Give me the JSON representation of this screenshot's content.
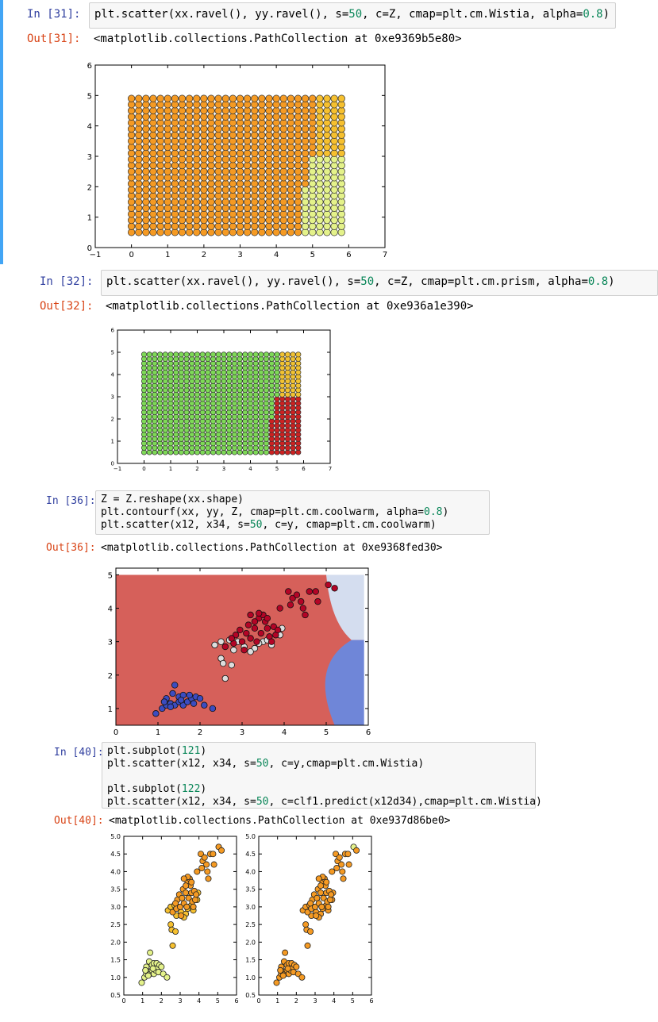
{
  "cells": [
    {
      "in_prompt": "In [31]:",
      "code_prefix": "plt.scatter(xx.ravel(), yy.ravel(), s=",
      "code_num1": "50",
      "code_mid": ", c=Z, cmap=plt.cm.Wistia, alpha=",
      "code_num2": "0.8",
      "code_suffix": ")",
      "out_prompt": "Out[31]:",
      "out_text": "<matplotlib.collections.PathCollection at 0xe9369b5e80>"
    },
    {
      "in_prompt": "In [32]:",
      "code_prefix": "plt.scatter(xx.ravel(), yy.ravel(), s=",
      "code_num1": "50",
      "code_mid": ", c=Z, cmap=plt.cm.prism, alpha=",
      "code_num2": "0.8",
      "code_suffix": ")",
      "out_prompt": "Out[32]:",
      "out_text": "<matplotlib.collections.PathCollection at 0xe936a1e390>"
    },
    {
      "in_prompt": "In [36]:",
      "line1": "Z = Z.reshape(xx.shape)",
      "line2_prefix": "plt.contourf(xx, yy, Z, cmap=plt.cm.coolwarm, alpha=",
      "line2_num": "0.8",
      "line2_suffix": ")",
      "line3_prefix": "plt.scatter(x12, x34, s=",
      "line3_num": "50",
      "line3_suffix": ", c=y, cmap=plt.cm.coolwarm)",
      "out_prompt": "Out[36]:",
      "out_text": "<matplotlib.collections.PathCollection at 0xe9368fed30>"
    },
    {
      "in_prompt": "In [40]:",
      "line1_prefix": "plt.subplot(",
      "line1_num": "121",
      "line1_suffix": ")",
      "line2_prefix": "plt.scatter(x12, x34, s=",
      "line2_num": "50",
      "line2_suffix": ", c=y,cmap=plt.cm.Wistia)",
      "line3_prefix": "plt.subplot(",
      "line3_num": "122",
      "line3_suffix": ")",
      "line4_prefix": "plt.scatter(x12, x34, s=",
      "line4_num": "50",
      "line4_suffix": ", c=clf1.predict(x12d34),cmap=plt.cm.Wistia)",
      "out_prompt": "Out[40]:",
      "out_text": "<matplotlib.collections.PathCollection at 0xe937d86be0>"
    }
  ],
  "colors": {
    "wistia_orange": "#f59a23",
    "wistia_amber": "#f6c02f",
    "wistia_lime": "#e4f28a",
    "prism_green": "#7ed957",
    "prism_yellow": "#f1c232",
    "prism_red": "#cc2222",
    "coolwarm_red_region": "#d6605a",
    "coolwarm_light_region": "#d4ddef",
    "coolwarm_blue_region": "#6f86d8",
    "point_red": "#b40426",
    "point_white": "#dddddd",
    "point_blue": "#3b4cc0"
  },
  "chart_data": [
    {
      "type": "scatter",
      "title": "",
      "xlim": [
        -1,
        7
      ],
      "ylim": [
        0,
        6
      ],
      "xticks": [
        -1,
        0,
        1,
        2,
        3,
        4,
        5,
        6,
        7
      ],
      "yticks": [
        0,
        1,
        2,
        3,
        4,
        5,
        6
      ],
      "grid_x": [
        0.0,
        5.8,
        0.2
      ],
      "grid_y": [
        0.5,
        5.0,
        0.2
      ],
      "colormap": "Wistia",
      "regions": "class 0 (orange) for x < 5.2; class 1 (amber) for x >= 5.2 and y >= 3.1; class 2 (lime) for x >= 5.2 and y < 3.1, boundary bending left toward x = 4.8 at low y"
    },
    {
      "type": "scatter",
      "title": "",
      "xlim": [
        -1,
        7
      ],
      "ylim": [
        0,
        6
      ],
      "xticks": [
        -1,
        0,
        1,
        2,
        3,
        4,
        5,
        6,
        7
      ],
      "yticks": [
        0,
        1,
        2,
        3,
        4,
        5,
        6
      ],
      "grid_x": [
        0.0,
        5.8,
        0.2
      ],
      "grid_y": [
        0.5,
        5.0,
        0.2
      ],
      "colormap": "prism",
      "regions": "class 0 (green) for x < 5.2; class 1 (yellow) for x >= 5.2 and y >= 3.1; class 2 (red) for x >= 5.2 and y < 3.1"
    },
    {
      "type": "scatter",
      "title": "",
      "xlim": [
        0,
        6
      ],
      "ylim": [
        0.5,
        5.2
      ],
      "xticks": [
        0,
        1,
        2,
        3,
        4,
        5,
        6
      ],
      "yticks": [
        1,
        2,
        3,
        4,
        5
      ],
      "colormap": "coolwarm",
      "background": "filled contour: red for most of plot, light blue region x > 5.1 and y > 3.1, blue region x > 5.1 and y < 3.1",
      "series": [
        {
          "points": [
            [
              0.95,
              0.85
            ],
            [
              1.1,
              1.0
            ],
            [
              1.2,
              1.1
            ],
            [
              1.3,
              1.15
            ],
            [
              1.4,
              1.1
            ],
            [
              1.5,
              1.2
            ],
            [
              1.6,
              1.1
            ],
            [
              1.7,
              1.2
            ],
            [
              1.8,
              1.3
            ],
            [
              1.2,
              1.3
            ],
            [
              1.35,
              1.45
            ],
            [
              1.5,
              1.35
            ],
            [
              1.6,
              1.4
            ],
            [
              1.75,
              1.4
            ],
            [
              1.9,
              1.35
            ],
            [
              2.0,
              1.3
            ],
            [
              1.85,
              1.15
            ],
            [
              2.1,
              1.1
            ],
            [
              2.3,
              1.0
            ],
            [
              1.4,
              1.7
            ],
            [
              1.55,
              1.25
            ],
            [
              1.3,
              1.05
            ],
            [
              1.15,
              1.2
            ]
          ]
        },
        {
          "points": [
            [
              2.35,
              2.9
            ],
            [
              2.5,
              2.5
            ],
            [
              2.55,
              2.35
            ],
            [
              2.75,
              2.3
            ],
            [
              2.6,
              1.9
            ],
            [
              2.8,
              2.75
            ],
            [
              2.5,
              3.0
            ],
            [
              2.7,
              3.05
            ],
            [
              2.9,
              3.0
            ],
            [
              3.05,
              2.85
            ],
            [
              3.3,
              2.8
            ],
            [
              3.5,
              3.0
            ],
            [
              3.6,
              3.05
            ],
            [
              3.7,
              2.9
            ],
            [
              3.9,
              3.2
            ],
            [
              3.95,
              3.4
            ],
            [
              3.2,
              2.7
            ],
            [
              3.4,
              2.95
            ]
          ]
        },
        {
          "points": [
            [
              2.6,
              2.85
            ],
            [
              2.8,
              2.95
            ],
            [
              2.85,
              3.2
            ],
            [
              2.95,
              3.35
            ],
            [
              3.0,
              3.0
            ],
            [
              3.1,
              3.25
            ],
            [
              3.15,
              3.5
            ],
            [
              3.2,
              3.1
            ],
            [
              3.3,
              3.4
            ],
            [
              3.35,
              3.0
            ],
            [
              3.4,
              3.7
            ],
            [
              3.45,
              3.25
            ],
            [
              3.55,
              3.6
            ],
            [
              3.6,
              3.4
            ],
            [
              3.65,
              3.15
            ],
            [
              3.7,
              3.0
            ],
            [
              3.75,
              3.45
            ],
            [
              3.8,
              3.2
            ],
            [
              3.85,
              3.35
            ],
            [
              3.5,
              3.8
            ],
            [
              3.6,
              3.7
            ],
            [
              3.3,
              3.6
            ],
            [
              2.75,
              3.1
            ],
            [
              3.05,
              2.75
            ],
            [
              3.9,
              4.0
            ],
            [
              4.15,
              4.1
            ],
            [
              4.2,
              4.3
            ],
            [
              4.4,
              4.2
            ],
            [
              4.45,
              4.0
            ],
            [
              4.6,
              4.5
            ],
            [
              4.75,
              4.5
            ],
            [
              4.8,
              4.2
            ],
            [
              4.1,
              4.5
            ],
            [
              4.3,
              4.4
            ],
            [
              5.05,
              4.7
            ],
            [
              5.2,
              4.6
            ],
            [
              4.5,
              3.8
            ],
            [
              3.4,
              3.85
            ],
            [
              3.2,
              3.8
            ]
          ]
        }
      ]
    },
    {
      "type": "scatter",
      "title": "",
      "xlim": [
        0,
        6
      ],
      "ylim": [
        0.5,
        5.0
      ],
      "xticks": [
        0,
        1,
        2,
        3,
        4,
        5,
        6
      ],
      "yticks": [
        0.5,
        1.0,
        1.5,
        2.0,
        2.5,
        3.0,
        3.5,
        4.0,
        4.5,
        5.0
      ],
      "ytick_labels": [
        "0.5",
        "1.0",
        "1.5",
        "2.0",
        "2.5",
        "3.0",
        "3.5",
        "4.0",
        "4.5",
        "5.0"
      ],
      "colormap": "Wistia",
      "coloring": "by true label y"
    },
    {
      "type": "scatter",
      "title": "",
      "xlim": [
        0,
        6
      ],
      "ylim": [
        0.5,
        5.0
      ],
      "xticks": [
        0,
        1,
        2,
        3,
        4,
        5,
        6
      ],
      "yticks": [
        0.5,
        1.0,
        1.5,
        2.0,
        2.5,
        3.0,
        3.5,
        4.0,
        4.5,
        5.0
      ],
      "ytick_labels": [
        "0.5",
        "1.0",
        "1.5",
        "2.0",
        "2.5",
        "3.0",
        "3.5",
        "4.0",
        "4.5",
        "5.0"
      ],
      "colormap": "Wistia",
      "coloring": "by clf1.predict(x12d34)"
    }
  ]
}
